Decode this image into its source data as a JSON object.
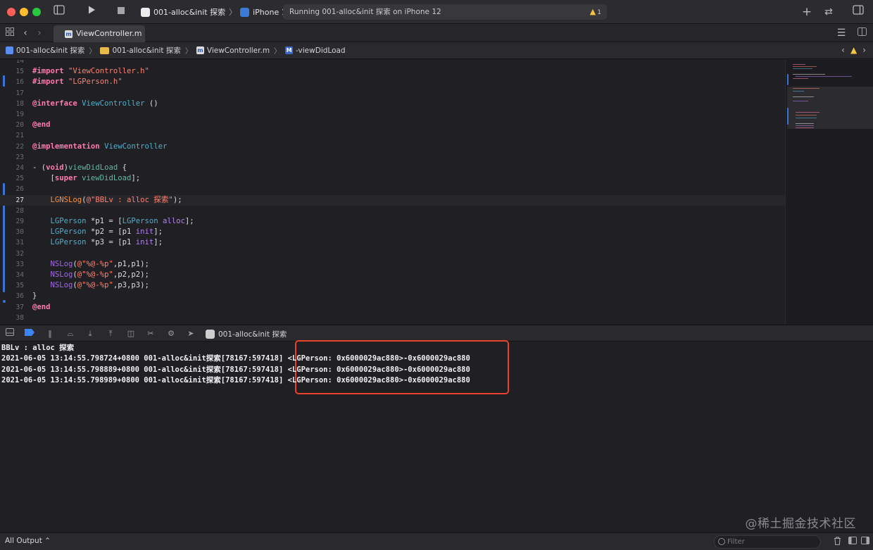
{
  "window": {
    "scheme": {
      "project": "001-alloc&init 探索",
      "device": "iPhone 12"
    },
    "activity": {
      "status": "Running 001-alloc&init 探索 on iPhone 12",
      "warning_count": "1"
    }
  },
  "tabs": [
    {
      "label": "ViewController.m"
    }
  ],
  "breadcrumb": {
    "project": "001-alloc&init 探索",
    "folder": "001-alloc&init 探索",
    "file": "ViewController.m",
    "method": "-viewDidLoad"
  },
  "editor": {
    "current_line": 27,
    "lines": [
      {
        "n": "14"
      },
      {
        "n": "15",
        "code": "#import \"ViewController.h\""
      },
      {
        "n": "16",
        "code": "#import \"LGPerson.h\""
      },
      {
        "n": "17"
      },
      {
        "n": "18",
        "code": "@interface ViewController ()"
      },
      {
        "n": "19"
      },
      {
        "n": "20",
        "code": "@end"
      },
      {
        "n": "21"
      },
      {
        "n": "22",
        "code": "@implementation ViewController"
      },
      {
        "n": "23"
      },
      {
        "n": "24",
        "code": "- (void)viewDidLoad {"
      },
      {
        "n": "25",
        "code": "    [super viewDidLoad];"
      },
      {
        "n": "26"
      },
      {
        "n": "27",
        "code": "    LGNSLog(@\"BBLv : alloc 探索\");"
      },
      {
        "n": "28"
      },
      {
        "n": "29",
        "code": "    LGPerson *p1 = [LGPerson alloc];"
      },
      {
        "n": "30",
        "code": "    LGPerson *p2 = [p1 init];"
      },
      {
        "n": "31",
        "code": "    LGPerson *p3 = [p1 init];"
      },
      {
        "n": "32"
      },
      {
        "n": "33",
        "code": "    NSLog(@\"%@-%p\",p1,p1);"
      },
      {
        "n": "34",
        "code": "    NSLog(@\"%@-%p\",p2,p2);"
      },
      {
        "n": "35",
        "code": "    NSLog(@\"%@-%p\",p3,p3);"
      },
      {
        "n": "36",
        "code": "}"
      },
      {
        "n": "37",
        "code": "@end"
      },
      {
        "n": "38"
      }
    ]
  },
  "debug": {
    "target": "001-alloc&init 探索"
  },
  "console": {
    "lines": [
      "BBLv : alloc 探索",
      "2021-06-05 13:14:55.798724+0800 001-alloc&init探索[78167:597418] <LGPerson: 0x6000029ac880>-0x6000029ac880",
      "2021-06-05 13:14:55.798889+0800 001-alloc&init探索[78167:597418] <LGPerson: 0x6000029ac880>-0x6000029ac880",
      "2021-06-05 13:14:55.798989+0800 001-alloc&init探索[78167:597418] <LGPerson: 0x6000029ac880>-0x6000029ac880"
    ],
    "highlight_color": "#e8412c",
    "watermark": "@稀土掘金技术社区"
  },
  "footer": {
    "output_mode": "All Output ⌃",
    "filter_placeholder": "Filter"
  },
  "colors": {
    "accent": "#3a86f5",
    "keyword": "#ff7ab2",
    "string": "#ff8170",
    "class": "#4eb0cc"
  }
}
